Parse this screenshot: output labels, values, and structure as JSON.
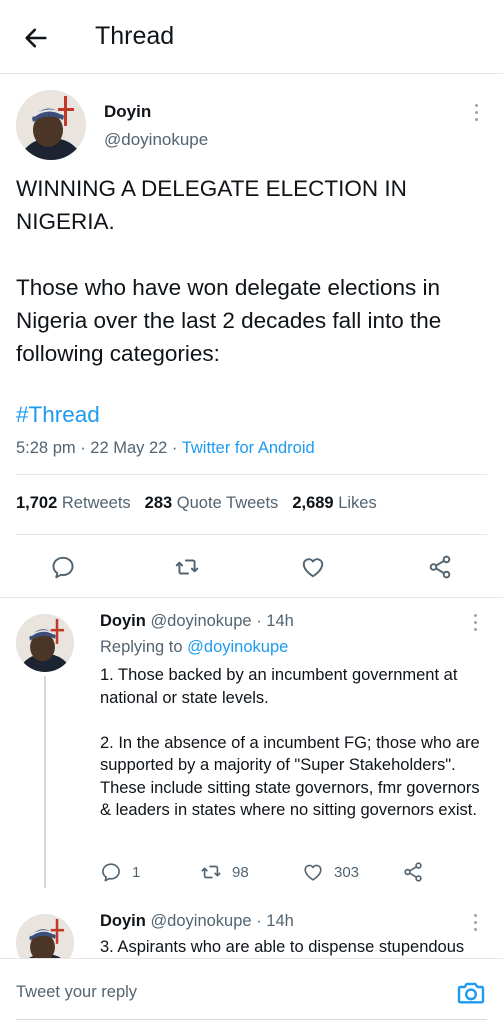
{
  "header": {
    "title": "Thread"
  },
  "main_tweet": {
    "name": "Doyin",
    "handle": "@doyinokupe",
    "paragraphs": [
      "WINNING A DELEGATE ELECTION IN NIGERIA.",
      "Those who have won delegate elections in Nigeria over the last 2 decades fall into the following categories:"
    ],
    "hashtag": "#Thread",
    "time": "5:28 pm",
    "date": "22 May 22",
    "source": "Twitter for Android",
    "retweets": {
      "count": "1,702",
      "label": "Retweets"
    },
    "quotes": {
      "count": "283",
      "label": "Quote Tweets"
    },
    "likes": {
      "count": "2,689",
      "label": "Likes"
    }
  },
  "replies": [
    {
      "name": "Doyin",
      "handle": "@doyinokupe",
      "time": "· 14h",
      "replying_label": "Replying to",
      "replying_to": "@doyinokupe",
      "paragraphs": [
        "1. Those backed by an incumbent government at national or state levels.",
        "2. In the absence of a incumbent FG; those who are supported by a majority of \"Super Stakeholders\". These include sitting state governors, fmr governors & leaders in states where no sitting governors exist."
      ],
      "reply_count": "1",
      "retweet_count": "98",
      "like_count": "303"
    },
    {
      "name": "Doyin",
      "handle": "@doyinokupe",
      "time": "· 14h",
      "text": "3. Aspirants who are able to dispense stupendous"
    }
  ],
  "composer": {
    "placeholder": "Tweet your reply"
  },
  "colors": {
    "accent": "#1d9bf0",
    "muted": "#536471",
    "text": "#0f1419"
  },
  "icons": [
    "back-arrow-icon",
    "more-icon",
    "reply-icon",
    "retweet-icon",
    "like-icon",
    "share-icon",
    "camera-icon"
  ]
}
